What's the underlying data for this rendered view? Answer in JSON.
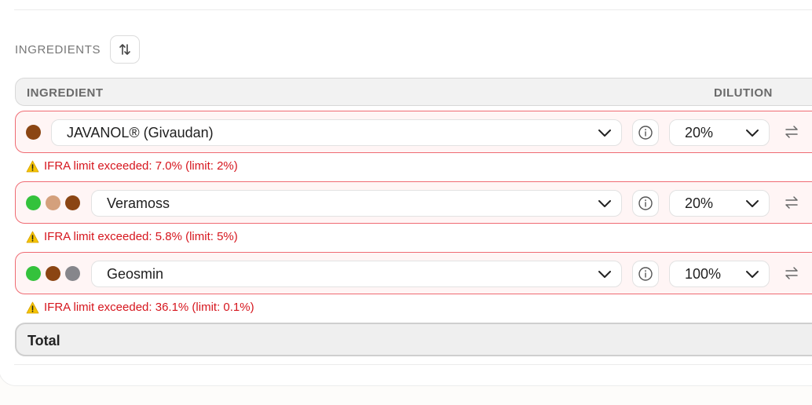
{
  "section": {
    "title": "INGREDIENTS"
  },
  "table": {
    "col_ingredient": "INGREDIENT",
    "col_dilution": "DILUTION"
  },
  "colors": {
    "error": "#d6161e",
    "row_border": "#ef6b73",
    "row_bg": "#fff5f5"
  },
  "rows": [
    {
      "name": "JAVANOL® (Givaudan)",
      "dots": [
        "#8b4513"
      ],
      "dilution": "20%",
      "warning": "IFRA limit exceeded: 7.0% (limit: 2%)"
    },
    {
      "name": "Veramoss",
      "dots": [
        "#34c23c",
        "#d4a07c",
        "#8b4513"
      ],
      "dilution": "20%",
      "warning": "IFRA limit exceeded: 5.8% (limit: 5%)"
    },
    {
      "name": "Geosmin",
      "dots": [
        "#34c23c",
        "#8b4513",
        "#86868b"
      ],
      "dilution": "100%",
      "warning": "IFRA limit exceeded: 36.1% (limit: 0.1%)"
    }
  ],
  "total": {
    "label": "Total"
  },
  "icons": {
    "sort": "sort-arrows-icon",
    "chevron": "chevron-down-icon",
    "info": "info-icon",
    "swap": "swap-arrows-icon",
    "warning": "warning-icon"
  }
}
